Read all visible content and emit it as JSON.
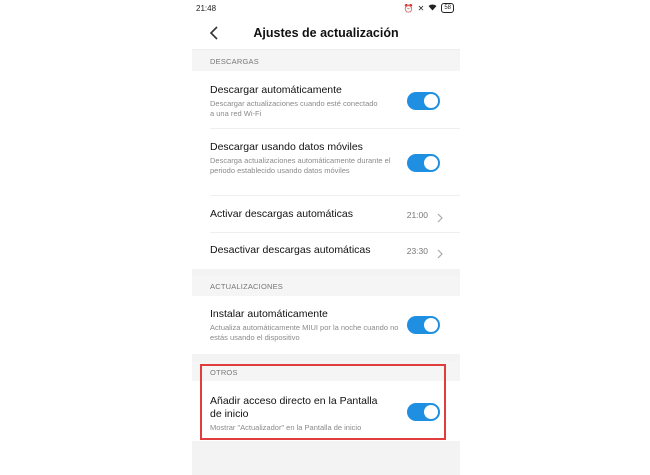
{
  "status_bar": {
    "time": "21:48",
    "battery": "58"
  },
  "header": {
    "title": "Ajustes de actualización"
  },
  "sections": {
    "descargas": {
      "title": "DESCARGAS",
      "auto_download": {
        "label": "Descargar automáticamente",
        "description": "Descargar actualizaciones cuando esté conectado a una red Wi-Fi",
        "enabled": true
      },
      "mobile_data": {
        "label": "Descargar usando datos móviles",
        "description": "Descarga actualizaciones automáticamente durante el periodo establecido usando datos móviles",
        "enabled": true
      },
      "activate": {
        "label": "Activar descargas automáticas",
        "value": "21:00"
      },
      "deactivate": {
        "label": "Desactivar descargas automáticas",
        "value": "23:30"
      }
    },
    "actualizaciones": {
      "title": "ACTUALIZACIONES",
      "auto_install": {
        "label": "Instalar automáticamente",
        "description": "Actualiza automáticamente MIUI por la noche cuando no estás usando el dispositivo",
        "enabled": true
      }
    },
    "otros": {
      "title": "OTROS",
      "shortcut": {
        "label": "Añadir acceso directo en la Pantalla de inicio",
        "description": "Mostrar \"Actualizador\" en la Pantalla de inicio",
        "enabled": true
      }
    }
  },
  "colors": {
    "toggle_on": "#1e8fe1",
    "highlight": "#e03d3d"
  },
  "icons": [
    "back-arrow-icon",
    "chevron-right-icon",
    "alarm-icon",
    "mute-icon",
    "wifi-icon",
    "battery-icon"
  ]
}
